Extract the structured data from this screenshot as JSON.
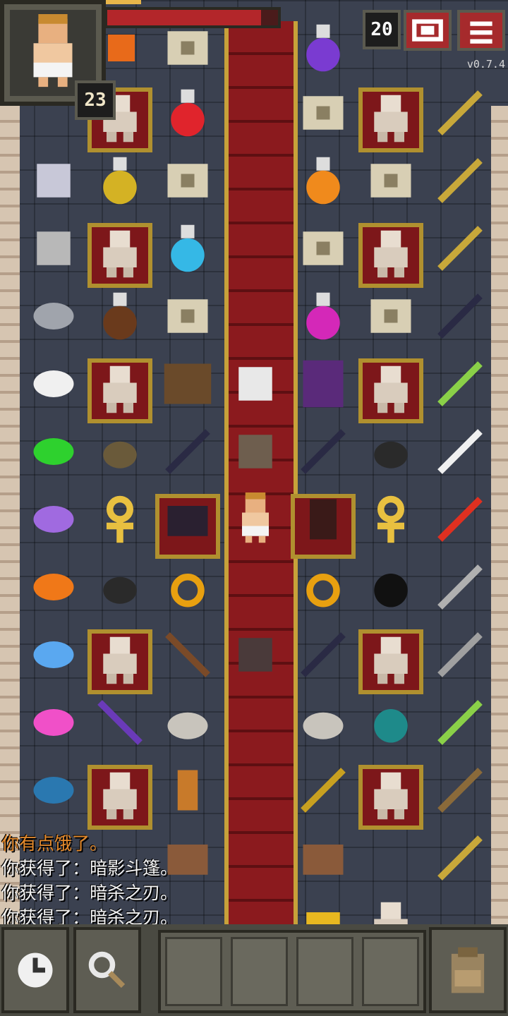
{
  "hud": {
    "hero_level": "23",
    "depth": "20",
    "version": "v0.7.4",
    "hp_fraction": 0.9
  },
  "buttons": {
    "journal_icon": "journal-icon",
    "menu_icon": "menu-icon",
    "wait_icon": "clock-icon",
    "search_icon": "magnifier-icon",
    "backpack_icon": "backpack-icon"
  },
  "quickslots": [
    {
      "item": ""
    },
    {
      "item": ""
    },
    {
      "item": ""
    },
    {
      "item": ""
    }
  ],
  "log": [
    {
      "text": "你有点饿了。",
      "type": "warning"
    },
    {
      "text": "你获得了：暗影斗篷。",
      "type": "normal"
    },
    {
      "text": "你获得了：暗杀之刃。",
      "type": "normal"
    },
    {
      "text": "你获得了：暗杀之刃。",
      "type": "normal"
    }
  ],
  "colors": {
    "warning_text": "#e58a2b",
    "hp": "#b3262a",
    "carpet": "#7a1418",
    "gold": "#c7a13a"
  }
}
